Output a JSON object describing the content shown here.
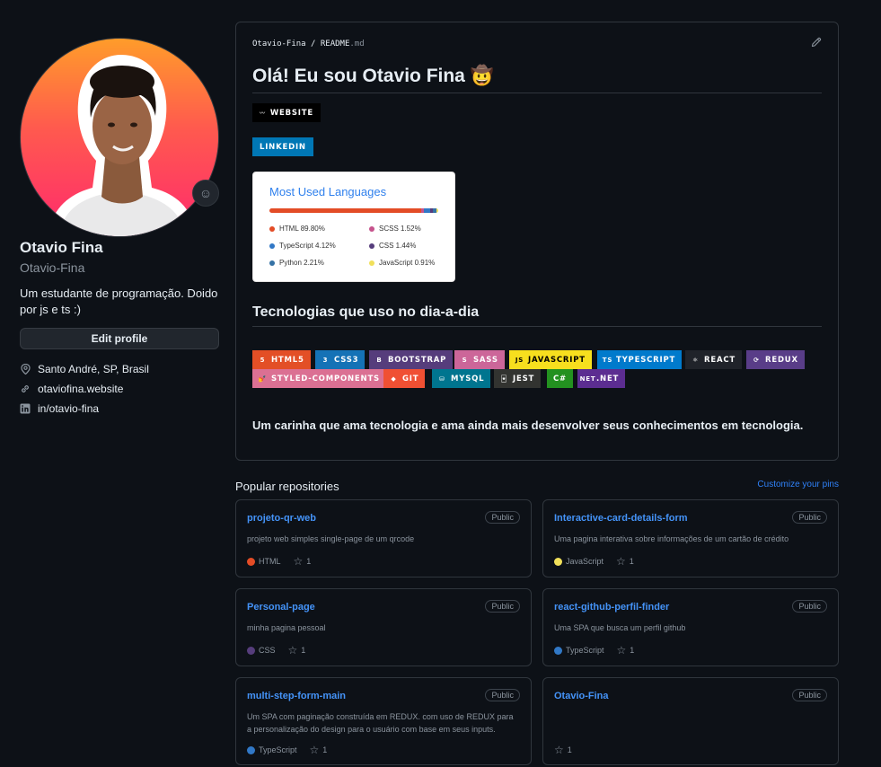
{
  "profile": {
    "name": "Otavio Fina",
    "login": "Otavio-Fina",
    "bio": "Um estudante de programação. Doido por js e ts :)",
    "edit_label": "Edit profile",
    "location": "Santo André, SP, Brasil",
    "website": "otaviofina.website",
    "linkedin": "in/otavio-fina"
  },
  "readme": {
    "owner": "Otavio-Fina",
    "file_base": "README",
    "file_ext": ".md",
    "heading": "Olá! Eu sou Otavio Fina 🤠",
    "badge_website": "WEBSITE",
    "badge_linkedin": "LINKEDIN",
    "languages_card": {
      "title": "Most Used Languages",
      "items": [
        {
          "name": "HTML",
          "percent": "89.80%",
          "color": "#e34c26"
        },
        {
          "name": "SCSS",
          "percent": "1.52%",
          "color": "#c6538c"
        },
        {
          "name": "TypeScript",
          "percent": "4.12%",
          "color": "#3178c6"
        },
        {
          "name": "CSS",
          "percent": "1.44%",
          "color": "#563d7c"
        },
        {
          "name": "Python",
          "percent": "2.21%",
          "color": "#3572a5"
        },
        {
          "name": "JavaScript",
          "percent": "0.91%",
          "color": "#f1e05a"
        }
      ]
    },
    "tech_heading": "Tecnologias que uso no dia-a-dia",
    "tech_badges": [
      {
        "label": "HTML5",
        "bg": "#e34f26",
        "fg": "#ffffff",
        "icon": "5"
      },
      {
        "label": "CSS3",
        "bg": "#1572b6",
        "fg": "#ffffff",
        "icon": "3"
      },
      {
        "label": "BOOTSTRAP",
        "bg": "#563d7c",
        "fg": "#ffffff",
        "icon": "B"
      },
      {
        "label": "SASS",
        "bg": "#cc6699",
        "fg": "#ffffff",
        "icon": "S"
      },
      {
        "label": "JAVASCRIPT",
        "bg": "#f7df1e",
        "fg": "#000000",
        "icon": "JS"
      },
      {
        "label": "TYPESCRIPT",
        "bg": "#007acc",
        "fg": "#ffffff",
        "icon": "TS"
      },
      {
        "label": "REACT",
        "bg": "#20232a",
        "fg": "#ffffff",
        "icon": "⚛"
      },
      {
        "label": "REDUX",
        "bg": "#593d88",
        "fg": "#ffffff",
        "icon": "⟳"
      },
      {
        "label": "STYLED-COMPONENTS",
        "bg": "#db7093",
        "fg": "#ffffff",
        "icon": "💅"
      },
      {
        "label": "GIT",
        "bg": "#f05033",
        "fg": "#ffffff",
        "icon": "◆"
      },
      {
        "label": "MYSQL",
        "bg": "#00758f",
        "fg": "#ffffff",
        "icon": "⛁"
      },
      {
        "label": "JEST",
        "bg": "#323330",
        "fg": "#ffffff",
        "icon": "🃏"
      },
      {
        "label": "C#",
        "bg": "#239120",
        "fg": "#ffffff",
        "icon": ""
      },
      {
        "label": ".NET",
        "bg": "#5c2d91",
        "fg": "#ffffff",
        "icon": "NET"
      }
    ],
    "paragraph": "Um carinha que ama tecnologia e ama ainda mais desenvolver seus conhecimentos em tecnologia."
  },
  "pinned": {
    "title": "Popular repositories",
    "customize": "Customize your pins",
    "public_label": "Public",
    "repos": [
      {
        "name": "projeto-qr-web",
        "description": "projeto web simples single-page de um qrcode",
        "language": "HTML",
        "lang_color": "#e34c26",
        "stars": "1"
      },
      {
        "name": "Interactive-card-details-form",
        "description": "Uma pagina interativa sobre informações de um cartão de crédito",
        "language": "JavaScript",
        "lang_color": "#f1e05a",
        "stars": "1"
      },
      {
        "name": "Personal-page",
        "description": "minha pagina pessoal",
        "language": "CSS",
        "lang_color": "#563d7c",
        "stars": "1"
      },
      {
        "name": "react-github-perfil-finder",
        "description": "Uma SPA que busca um perfil github",
        "language": "TypeScript",
        "lang_color": "#3178c6",
        "stars": "1"
      },
      {
        "name": "multi-step-form-main",
        "description": "Um SPA com paginação construída em REDUX. com uso de REDUX para a personalização do design para o usuário com base em seus inputs.",
        "language": "TypeScript",
        "lang_color": "#3178c6",
        "stars": "1"
      },
      {
        "name": "Otavio-Fina",
        "description": "",
        "language": "",
        "lang_color": "",
        "stars": "1"
      }
    ]
  }
}
